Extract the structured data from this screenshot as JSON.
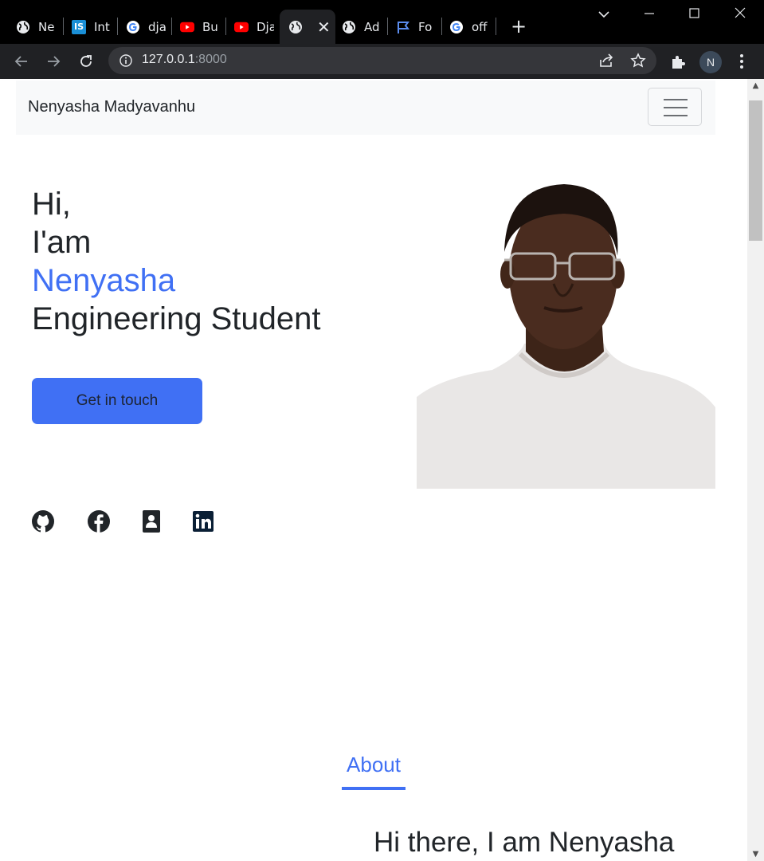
{
  "browser": {
    "tabs": [
      {
        "title": "Ne",
        "icon": "globe-icon"
      },
      {
        "title": "Int",
        "icon": "is-site-icon"
      },
      {
        "title": "dja",
        "icon": "google-icon"
      },
      {
        "title": "Bu",
        "icon": "youtube-icon"
      },
      {
        "title": "Dja",
        "icon": "youtube-icon"
      },
      {
        "title": "",
        "icon": "globe-icon",
        "active": true
      },
      {
        "title": "Ad",
        "icon": "globe-icon"
      },
      {
        "title": "Fo",
        "icon": "flag-icon"
      },
      {
        "title": "off",
        "icon": "google-icon"
      }
    ],
    "new_tab": "+",
    "url_host": "127.0.0.1",
    "url_port": ":8000",
    "profile_initial": "N",
    "colors": {
      "tabstrip": "#000000",
      "toolbar": "#202124",
      "omnibox": "#35363a"
    }
  },
  "navbar": {
    "brand": "Nenyasha Madyavanhu"
  },
  "hero": {
    "greeting": "Hi,",
    "intro": "I'am",
    "name": "Nenyasha",
    "role": "Engineering Student",
    "cta_label": "Get in touch"
  },
  "social": [
    {
      "icon": "github-icon"
    },
    {
      "icon": "facebook-icon"
    },
    {
      "icon": "contact-card-icon"
    },
    {
      "icon": "linkedin-icon"
    }
  ],
  "about": {
    "section_title": "About",
    "heading": "Hi there, I am Nenyasha"
  },
  "colors": {
    "accent": "#4070f4",
    "text": "#212529",
    "navbar_bg": "#f8f9fa"
  }
}
